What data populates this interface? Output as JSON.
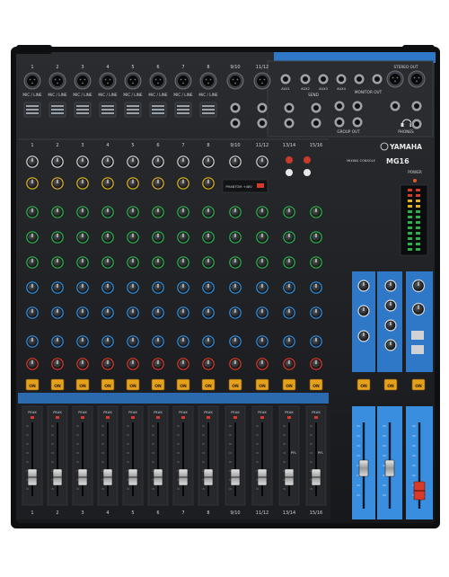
{
  "product": {
    "brand": "YAMAHA",
    "model": "MG16",
    "subtitle": "MIXING CONSOLE"
  },
  "channels": {
    "numbers": [
      "1",
      "2",
      "3",
      "4",
      "5",
      "6",
      "7",
      "8",
      "9/10",
      "11/12",
      "13/14",
      "15/16"
    ],
    "input_label": "MIC / LINE",
    "mono_count": 8,
    "on_label": "ON",
    "peak_label": "PEAK",
    "pfl_label": "PFL"
  },
  "top_panel": {
    "aux_labels": [
      "AUX1",
      "AUX2",
      "AUX3",
      "AUX4"
    ],
    "send_label": "SEND",
    "monitor_out_label": "MONITOR OUT",
    "stereo_out_label": "STEREO OUT",
    "group_out_label": "GROUP OUT",
    "phones_label": "PHONES",
    "power_label": "POWER",
    "phantom_label": "PHANTOM +48V"
  },
  "colors": {
    "panel": "#1b1d20",
    "accent_blue": "#2f78c8",
    "fader_strip_blue": "#3a8ee0",
    "knob_green": "#2bb24c",
    "knob_blue": "#2d8fe0",
    "knob_yellow": "#e0b020",
    "knob_red": "#d83a2a",
    "on_button": "#e6a11c"
  },
  "icons": [
    "xlr-jack-icon",
    "trs-jack-icon",
    "rotary-knob-icon",
    "fader-icon",
    "headphones-icon",
    "power-led-icon"
  ]
}
